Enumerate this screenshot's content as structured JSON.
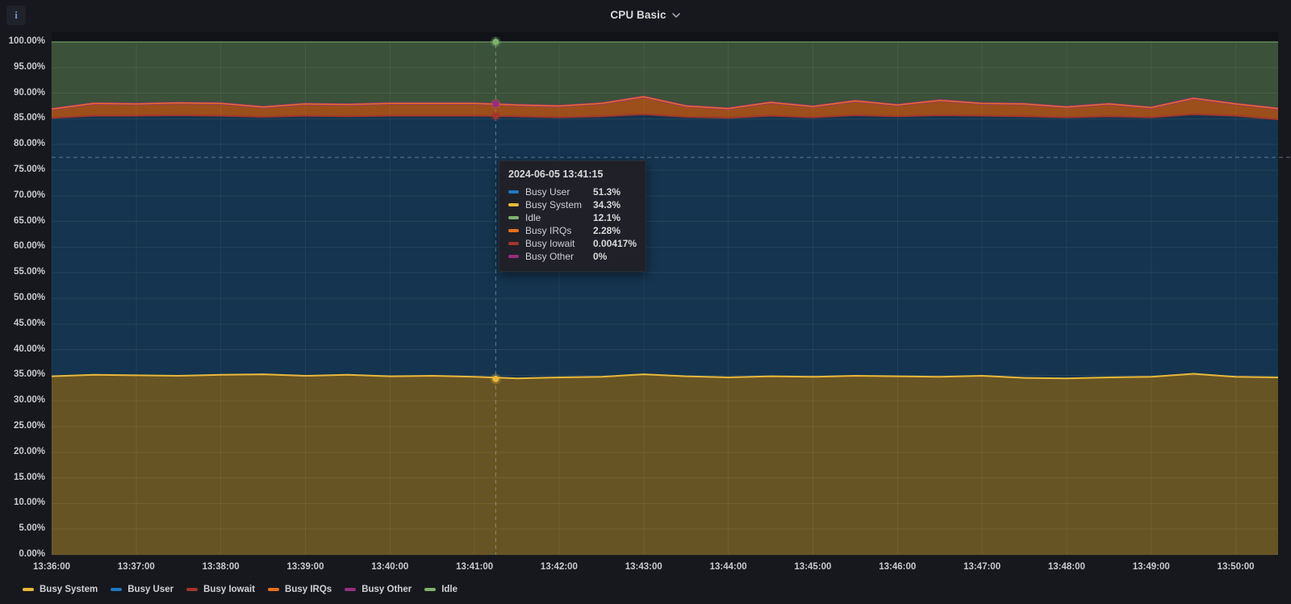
{
  "panel": {
    "title": "CPU Basic",
    "info_icon_glyph": "i"
  },
  "tooltip": {
    "timestamp": "2024-06-05 13:41:15",
    "rows": [
      {
        "name": "Busy User",
        "value": "51.3%",
        "color": "#1F78C1"
      },
      {
        "name": "Busy System",
        "value": "34.3%",
        "color": "#EAB839"
      },
      {
        "name": "Idle",
        "value": "12.1%",
        "color": "#7EB26D"
      },
      {
        "name": "Busy IRQs",
        "value": "2.28%",
        "color": "#E8701B"
      },
      {
        "name": "Busy Iowait",
        "value": "0.00417%",
        "color": "#A3352C"
      },
      {
        "name": "Busy Other",
        "value": "0%",
        "color": "#962D82"
      }
    ]
  },
  "legend": [
    {
      "name": "Busy System",
      "color": "#EAB839"
    },
    {
      "name": "Busy User",
      "color": "#1F78C1"
    },
    {
      "name": "Busy Iowait",
      "color": "#A3352C"
    },
    {
      "name": "Busy IRQs",
      "color": "#E8701B"
    },
    {
      "name": "Busy Other",
      "color": "#962D82"
    },
    {
      "name": "Idle",
      "color": "#7EB26D"
    }
  ],
  "chart_data": {
    "type": "area",
    "stacked": true,
    "unit": "percent",
    "ylim": [
      0,
      100
    ],
    "grid": true,
    "legend_position": "bottom",
    "y_ticks": [
      "0.00%",
      "5.00%",
      "10.00%",
      "15.00%",
      "20.00%",
      "25.00%",
      "30.00%",
      "35.00%",
      "40.00%",
      "45.00%",
      "50.00%",
      "55.00%",
      "60.00%",
      "65.00%",
      "70.00%",
      "75.00%",
      "80.00%",
      "85.00%",
      "90.00%",
      "95.00%",
      "100.00%"
    ],
    "x_ticks": [
      "13:36:00",
      "13:37:00",
      "13:38:00",
      "13:39:00",
      "13:40:00",
      "13:41:00",
      "13:42:00",
      "13:43:00",
      "13:44:00",
      "13:45:00",
      "13:46:00",
      "13:47:00",
      "13:48:00",
      "13:49:00",
      "13:50:00"
    ],
    "x": [
      "13:36:00",
      "13:36:30",
      "13:37:00",
      "13:37:30",
      "13:38:00",
      "13:38:30",
      "13:39:00",
      "13:39:30",
      "13:40:00",
      "13:40:30",
      "13:41:00",
      "13:41:30",
      "13:42:00",
      "13:42:30",
      "13:43:00",
      "13:43:30",
      "13:44:00",
      "13:44:30",
      "13:45:00",
      "13:45:30",
      "13:46:00",
      "13:46:30",
      "13:47:00",
      "13:47:30",
      "13:48:00",
      "13:48:30",
      "13:49:00",
      "13:49:30",
      "13:50:00",
      "13:50:30"
    ],
    "series": [
      {
        "name": "Busy System",
        "color": "#EAB839",
        "fill_opacity": 0.4,
        "stroke_width": 2,
        "values": [
          34.8,
          35.1,
          35.0,
          34.9,
          35.1,
          35.2,
          34.9,
          35.1,
          34.8,
          34.9,
          34.7,
          34.4,
          34.6,
          34.7,
          35.2,
          34.8,
          34.6,
          34.8,
          34.7,
          34.9,
          34.8,
          34.7,
          34.9,
          34.5,
          34.4,
          34.6,
          34.7,
          35.3,
          34.7,
          34.6
        ]
      },
      {
        "name": "Busy User",
        "color": "#1F78C1",
        "fill_opacity": 0.33,
        "stroke_width": 1,
        "values": [
          50.4,
          50.5,
          50.6,
          50.8,
          50.5,
          50.2,
          50.7,
          50.4,
          50.8,
          50.7,
          50.9,
          51.1,
          50.7,
          50.8,
          50.7,
          50.6,
          50.6,
          50.8,
          50.6,
          50.8,
          50.7,
          51.0,
          50.7,
          51.0,
          50.9,
          50.9,
          50.6,
          50.6,
          50.9,
          50.3
        ]
      },
      {
        "name": "Busy Iowait",
        "color": "#A3352C",
        "fill_opacity": 0,
        "stroke_width": 2,
        "values": [
          0.004,
          0.004,
          0.004,
          0.004,
          0.004,
          0.004,
          0.004,
          0.004,
          0.004,
          0.004,
          0.004,
          0.004,
          0.004,
          0.004,
          0.004,
          0.004,
          0.004,
          0.004,
          0.004,
          0.004,
          0.004,
          0.004,
          0.004,
          0.004,
          0.004,
          0.004,
          0.004,
          0.004,
          0.004,
          0.004
        ]
      },
      {
        "name": "Busy IRQs",
        "color": "#E8701B",
        "fill_opacity": 0.65,
        "stroke_width": 1.5,
        "values": [
          1.7,
          2.4,
          2.3,
          2.4,
          2.4,
          1.9,
          2.3,
          2.3,
          2.4,
          2.4,
          2.4,
          2.2,
          2.2,
          2.5,
          3.4,
          2.1,
          1.8,
          2.6,
          2.1,
          2.8,
          2.2,
          2.9,
          2.4,
          2.4,
          2.0,
          2.4,
          1.9,
          3.1,
          2.3,
          2.1
        ]
      },
      {
        "name": "Busy Other",
        "color": "#962D82",
        "fill_opacity": 0,
        "stroke_width": 3,
        "values": [
          0,
          0,
          0,
          0,
          0,
          0,
          0,
          0,
          0,
          0,
          0,
          0,
          0,
          0,
          0,
          0,
          0,
          0,
          0,
          0,
          0,
          0,
          0,
          0,
          0,
          0,
          0,
          0,
          0,
          0
        ]
      },
      {
        "name": "Idle",
        "color": "#7EB26D",
        "fill_opacity": 0.4,
        "stroke_width": 1,
        "values": [
          13.1,
          12.0,
          12.1,
          11.9,
          12.0,
          12.7,
          12.1,
          12.2,
          12.0,
          12.0,
          12.0,
          12.3,
          12.5,
          12.0,
          10.7,
          12.5,
          13.0,
          11.8,
          12.6,
          11.5,
          12.3,
          11.4,
          12.0,
          12.1,
          12.7,
          12.1,
          12.8,
          11.0,
          12.1,
          13.0
        ]
      }
    ],
    "crosshair": {
      "time_label": "13:41:15",
      "x_index": 10.5,
      "y_percent": 77.5,
      "markers": [
        {
          "series": "Busy System",
          "color": "#EAB839",
          "value": 34.3
        },
        {
          "series": "Busy Iowait",
          "color": "#A3352C",
          "value": 85.6
        },
        {
          "series": "Busy IRQs",
          "color": "#E8701B",
          "value": 87.9
        },
        {
          "series": "Busy Other",
          "color": "#962D82",
          "value": 87.9
        },
        {
          "series": "Idle",
          "color": "#7EB26D",
          "value": 100
        }
      ]
    }
  }
}
